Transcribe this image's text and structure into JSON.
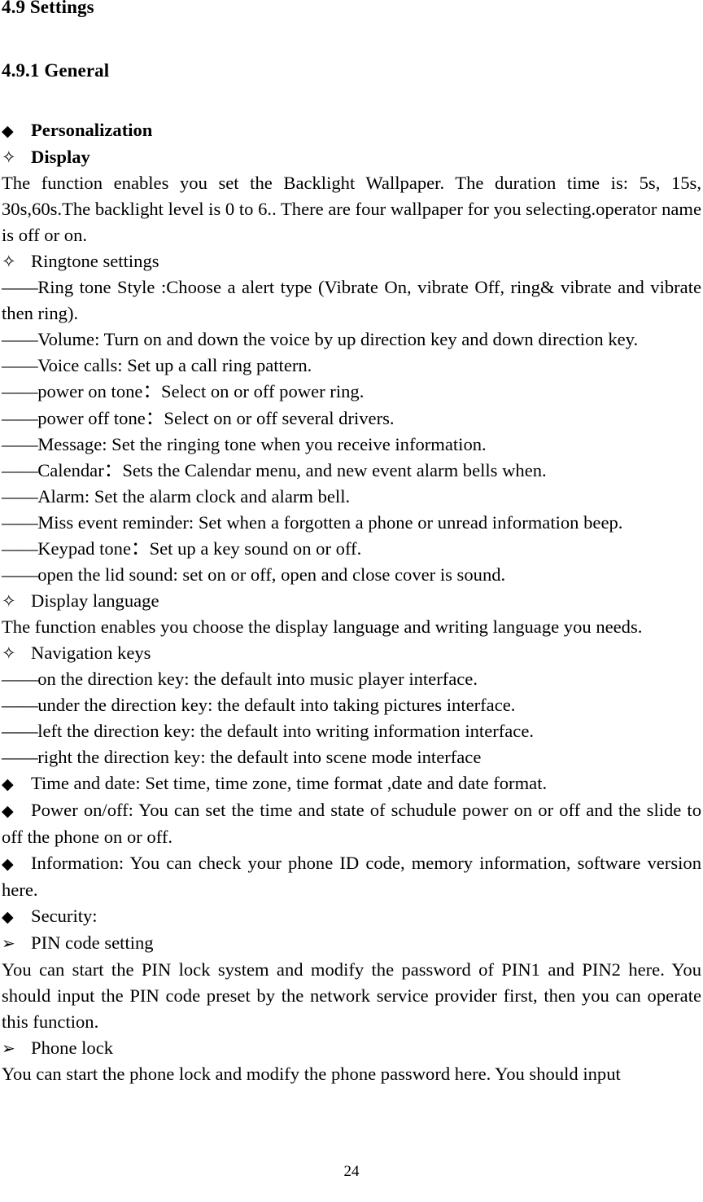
{
  "document": {
    "heading_main": "4.9 Settings",
    "heading_sub": "4.9.1 General",
    "page_number": "24",
    "bullets": {
      "diamond_filled": "◆",
      "star_open": "✧",
      "arrow_head": "➢",
      "em_dash": "——"
    }
  },
  "content": {
    "personalization": "Personalization",
    "display_heading": "Display",
    "display_para": "The function enables you set the   Backlight Wallpaper. The duration time is: 5s, 15s, 30s,60s.The backlight level is 0 to 6.. There are four wallpaper for you selecting.operator name is off or on.",
    "ringtone_settings": "Ringtone settings",
    "ringtone_items": [
      "Ring tone Style :Choose a alert type (Vibrate On, vibrate Off, ring& vibrate and vibrate then ring).",
      "Volume: Turn on and down the voice by up direction key and down direction key.",
      "Voice calls: Set up a call ring pattern.",
      "power on tone：Select on or off power ring.",
      "power off tone：Select on or off several drivers.",
      "Message: Set the ringing tone when you receive information.",
      "Calendar：Sets the Calendar menu, and new event alarm bells when.",
      "Alarm: Set the alarm clock and alarm bell.",
      "Miss event reminder: Set when a forgotten a phone or unread information beep.",
      "Keypad tone：Set up a key sound on or off.",
      "open the lid sound: set on or off, open and close cover is sound."
    ],
    "display_language_heading": "Display language",
    "display_language_para": "The function enables you choose the display language and writing language you needs.",
    "navigation_keys_heading": "Navigation keys",
    "navigation_items": [
      "on the direction key: the default into music player interface.",
      "under the direction key: the default into taking pictures interface.",
      "left the direction key: the default into writing information interface.",
      "right the direction key: the default into scene mode interface"
    ],
    "time_and_date": "Time and date: Set time, time zone, time format ,date and date format.",
    "power_on_off": "Power on/off: You can set the time and state of schudule power on or off and the slide to off the phone on or off.",
    "information": "Information: You can check your phone ID code, memory information, software version here.",
    "security": "Security:",
    "pin_code_setting_heading": "PIN code setting",
    "pin_code_setting_para": "You can start the PIN lock system and modify the password of PIN1 and PIN2 here. You should input the PIN code preset by the network service provider first, then you can operate this function.",
    "phone_lock_heading": "Phone lock",
    "phone_lock_para": "You can start the phone lock and modify the phone password here. You should input"
  }
}
